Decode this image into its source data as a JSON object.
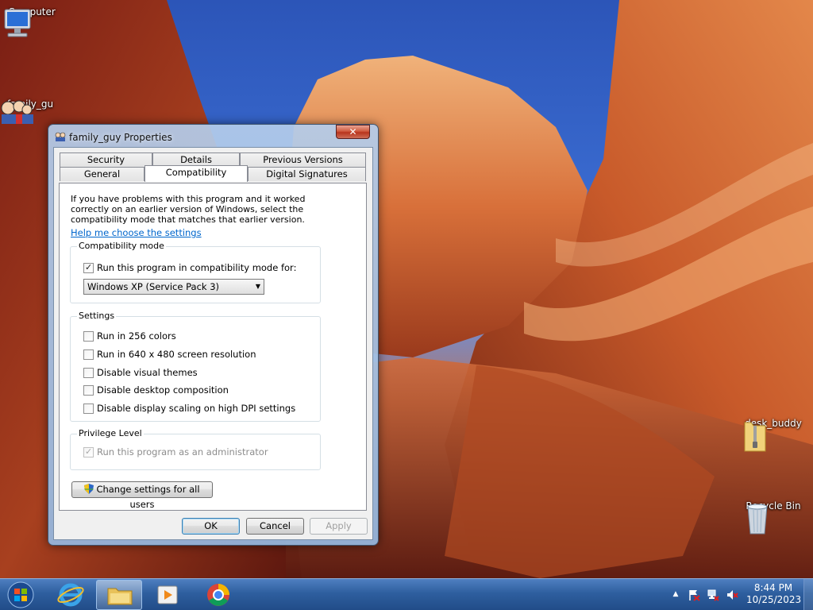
{
  "desktop": {
    "icons": [
      {
        "label": "Computer",
        "icon": "computer-icon"
      },
      {
        "label": "family_gu",
        "icon": "family-guy-shortcut-icon"
      },
      {
        "label": "desk_buddy",
        "icon": "zip-folder-icon"
      },
      {
        "label": "Recycle Bin",
        "icon": "recycle-bin-icon"
      }
    ]
  },
  "dialog": {
    "title": "family_guy Properties",
    "close_label": "✕",
    "tabs_row1": [
      "Security",
      "Details",
      "Previous Versions"
    ],
    "tabs_row2": [
      "General",
      "Compatibility",
      "Digital Signatures"
    ],
    "active_tab": "Compatibility",
    "intro": "If you have problems with this program and it worked correctly on an earlier version of Windows, select the compatibility mode that matches that earlier version.",
    "help_link": "Help me choose the settings",
    "compat_mode": {
      "group_label": "Compatibility mode",
      "checkbox_label": "Run this program in compatibility mode for:",
      "checked": true,
      "selected_os": "Windows XP (Service Pack 3)"
    },
    "settings": {
      "group_label": "Settings",
      "options": [
        {
          "label": "Run in 256 colors",
          "checked": false
        },
        {
          "label": "Run in 640 x 480 screen resolution",
          "checked": false
        },
        {
          "label": "Disable visual themes",
          "checked": false
        },
        {
          "label": "Disable desktop composition",
          "checked": false
        },
        {
          "label": "Disable display scaling on high DPI settings",
          "checked": false
        }
      ]
    },
    "privilege": {
      "group_label": "Privilege Level",
      "checkbox_label": "Run this program as an administrator",
      "checked": true,
      "disabled": true
    },
    "change_all_users_label": "Change settings for all users",
    "ok_label": "OK",
    "cancel_label": "Cancel",
    "apply_label": "Apply"
  },
  "taskbar": {
    "pinned": [
      "start-orb-icon",
      "internet-explorer-icon",
      "file-explorer-icon",
      "media-player-icon",
      "chrome-icon"
    ],
    "tray": {
      "show_hidden": "▲",
      "icons": [
        "action-center-flag-icon",
        "network-icon",
        "volume-muted-icon"
      ]
    },
    "clock": {
      "time": "8:44 PM",
      "date": "10/25/2023"
    }
  },
  "colors": {
    "taskbar": "#2e5f9f",
    "link": "#0066cc",
    "close_button": "#c8452b"
  }
}
